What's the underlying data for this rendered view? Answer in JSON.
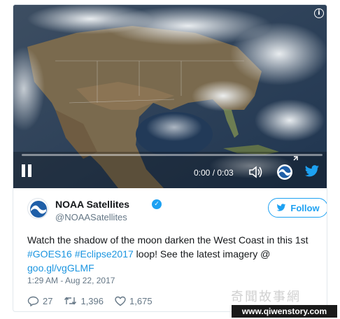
{
  "video": {
    "time_display": "0:00 / 0:03",
    "progress_fraction": 0.0
  },
  "author": {
    "name": "NOAA Satellites",
    "handle": "@NOAASatellites",
    "verified": true,
    "follow_label": "Follow"
  },
  "tweet": {
    "text_part1": "Watch the shadow of the moon darken the West Coast in this 1st ",
    "hashtag1": "#GOES16",
    "hashtag2": "#Eclipse2017",
    "text_part2": " loop! See the latest imagery @ ",
    "link": "goo.gl/vgGLMF",
    "timestamp": "1:29 AM - Aug 22, 2017"
  },
  "actions": {
    "replies": "27",
    "retweets": "1,396",
    "likes": "1,675"
  },
  "watermark": {
    "site": "www.qiwenstory.com",
    "cn_text": "奇聞故事網"
  },
  "colors": {
    "accent": "#1da1f2",
    "link": "#1b95e0",
    "text": "#14171a",
    "muted": "#657786"
  }
}
